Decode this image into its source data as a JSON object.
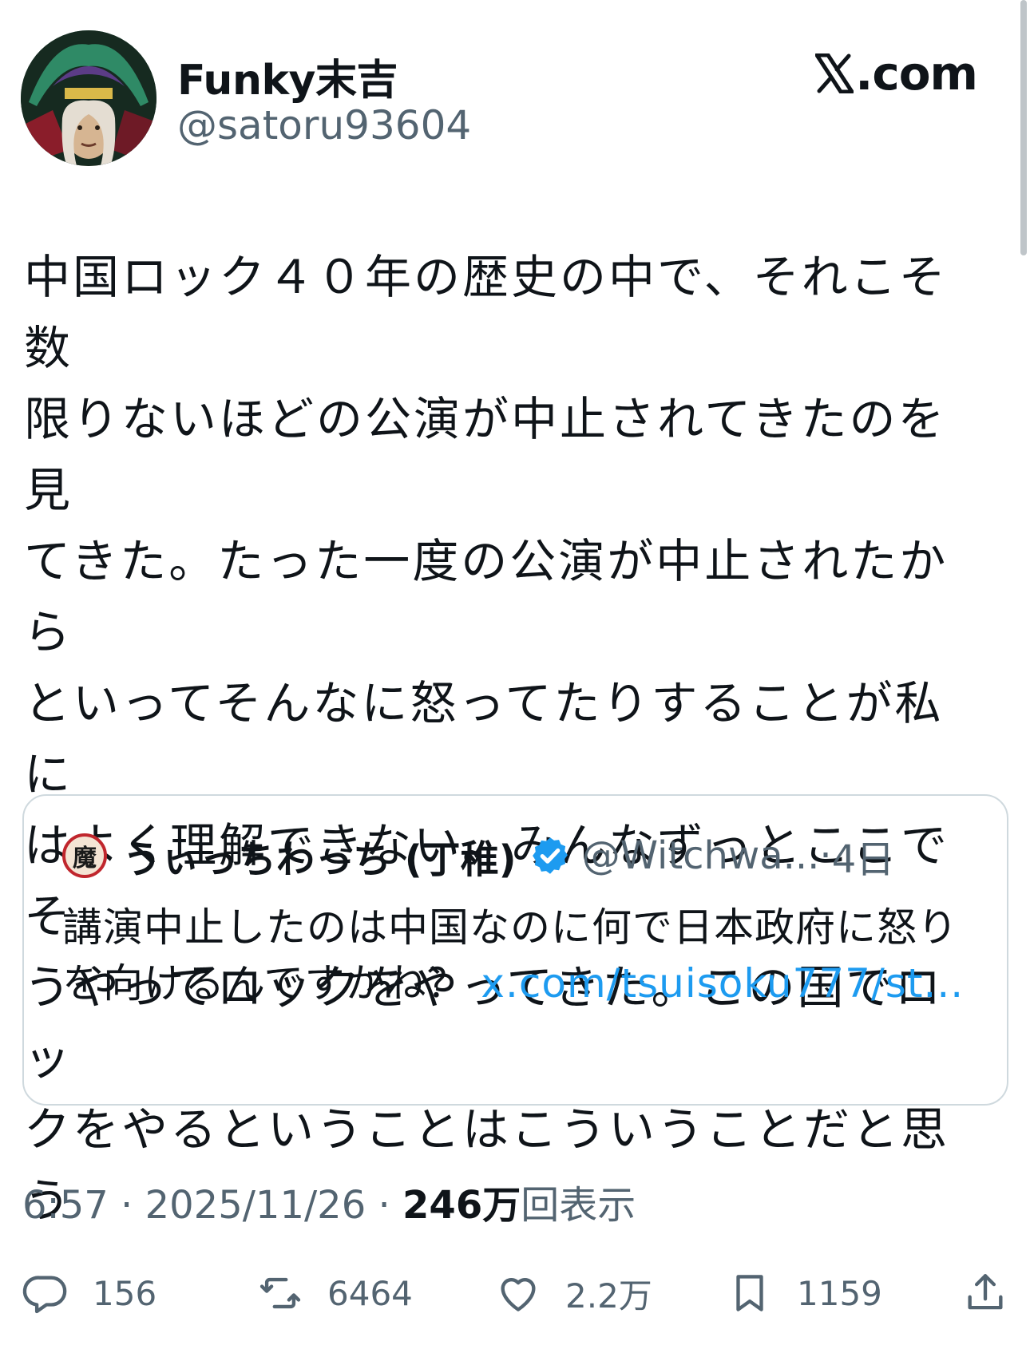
{
  "author": {
    "display_name": "Funky末吉",
    "handle": "@satoru93604"
  },
  "brand": {
    "label": ".com"
  },
  "tweet": {
    "lines": [
      "中国ロック４０年の歴史の中で、それこそ数",
      "限りないほどの公演が中止されてきたのを見",
      "てきた。たった一度の公演が中止されたから",
      "といってそんなに怒ってたりすることが私に",
      "はよく理解できない。みんなずっとここでそ",
      "うやってロックをやってきた。この国でロッ",
      "クをやるということはこういうことだと思う"
    ]
  },
  "quote": {
    "avatar_glyph": "魔",
    "display_name": "うぃっちわっち (丁稚)",
    "handle": "@Witchwa...",
    "separator": "·",
    "time": "4日",
    "text": "講演中止したのは中国なのに何で日本政府に怒りを向けるんですかね？ ",
    "link": "x.com/tsuisoku777/st..."
  },
  "meta": {
    "time": "6:57",
    "separator": " · ",
    "date": "2025/11/26",
    "views_count": "246万",
    "views_label": "回表示"
  },
  "actions": {
    "replies": "156",
    "reposts": "6464",
    "likes": "2.2万",
    "bookmarks": "1159"
  },
  "colors": {
    "text": "#0f1419",
    "secondary": "#536471",
    "link": "#1d9bf0",
    "border": "#cfd9de"
  }
}
